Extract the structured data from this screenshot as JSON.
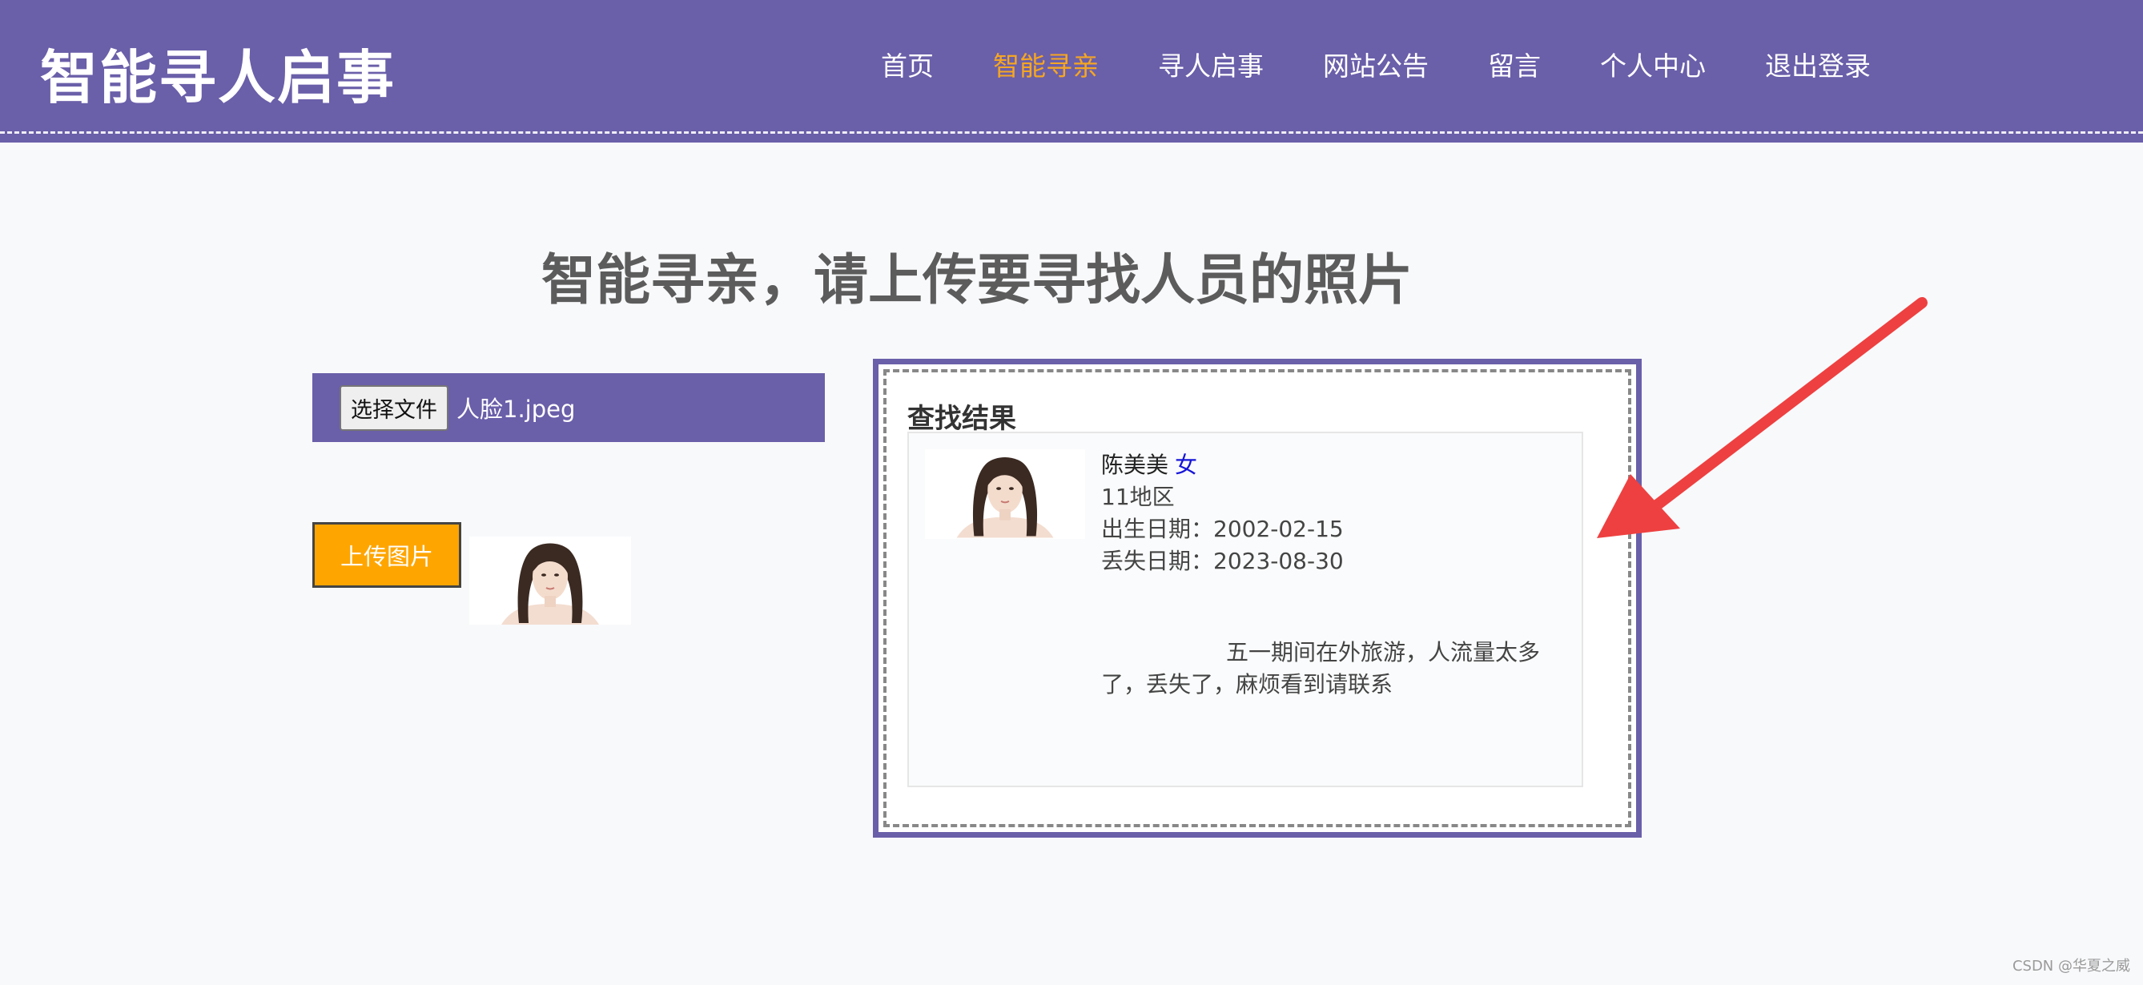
{
  "header": {
    "logo": "智能寻人启事",
    "nav": [
      {
        "label": "首页"
      },
      {
        "label": "智能寻亲",
        "active": true
      },
      {
        "label": "寻人启事"
      },
      {
        "label": "网站公告"
      },
      {
        "label": "留言"
      },
      {
        "label": "个人中心"
      },
      {
        "label": "退出登录"
      }
    ]
  },
  "main": {
    "title": "智能寻亲，请上传要寻找人员的照片",
    "file_input": {
      "button_label": "选择文件",
      "file_name": "人脸1.jpeg"
    },
    "upload_button": "上传图片",
    "result": {
      "heading": "查找结果",
      "name": "陈美美",
      "gender": "女",
      "region": "11地区",
      "birth_date": "出生日期：2002-02-15",
      "lost_date": "丢失日期：2023-08-30",
      "description": "五一期间在外旅游，人流量太多了，丢失了，麻烦看到请联系"
    }
  },
  "watermark": "CSDN @华夏之威",
  "colors": {
    "header_bg": "#6a5fa9",
    "nav_active": "#f5a623",
    "upload_button_bg": "#ffa500",
    "gender_text": "#1515d8",
    "arrow": "#ee4040"
  },
  "icons": {
    "arrow": "red-arrow-icon"
  }
}
